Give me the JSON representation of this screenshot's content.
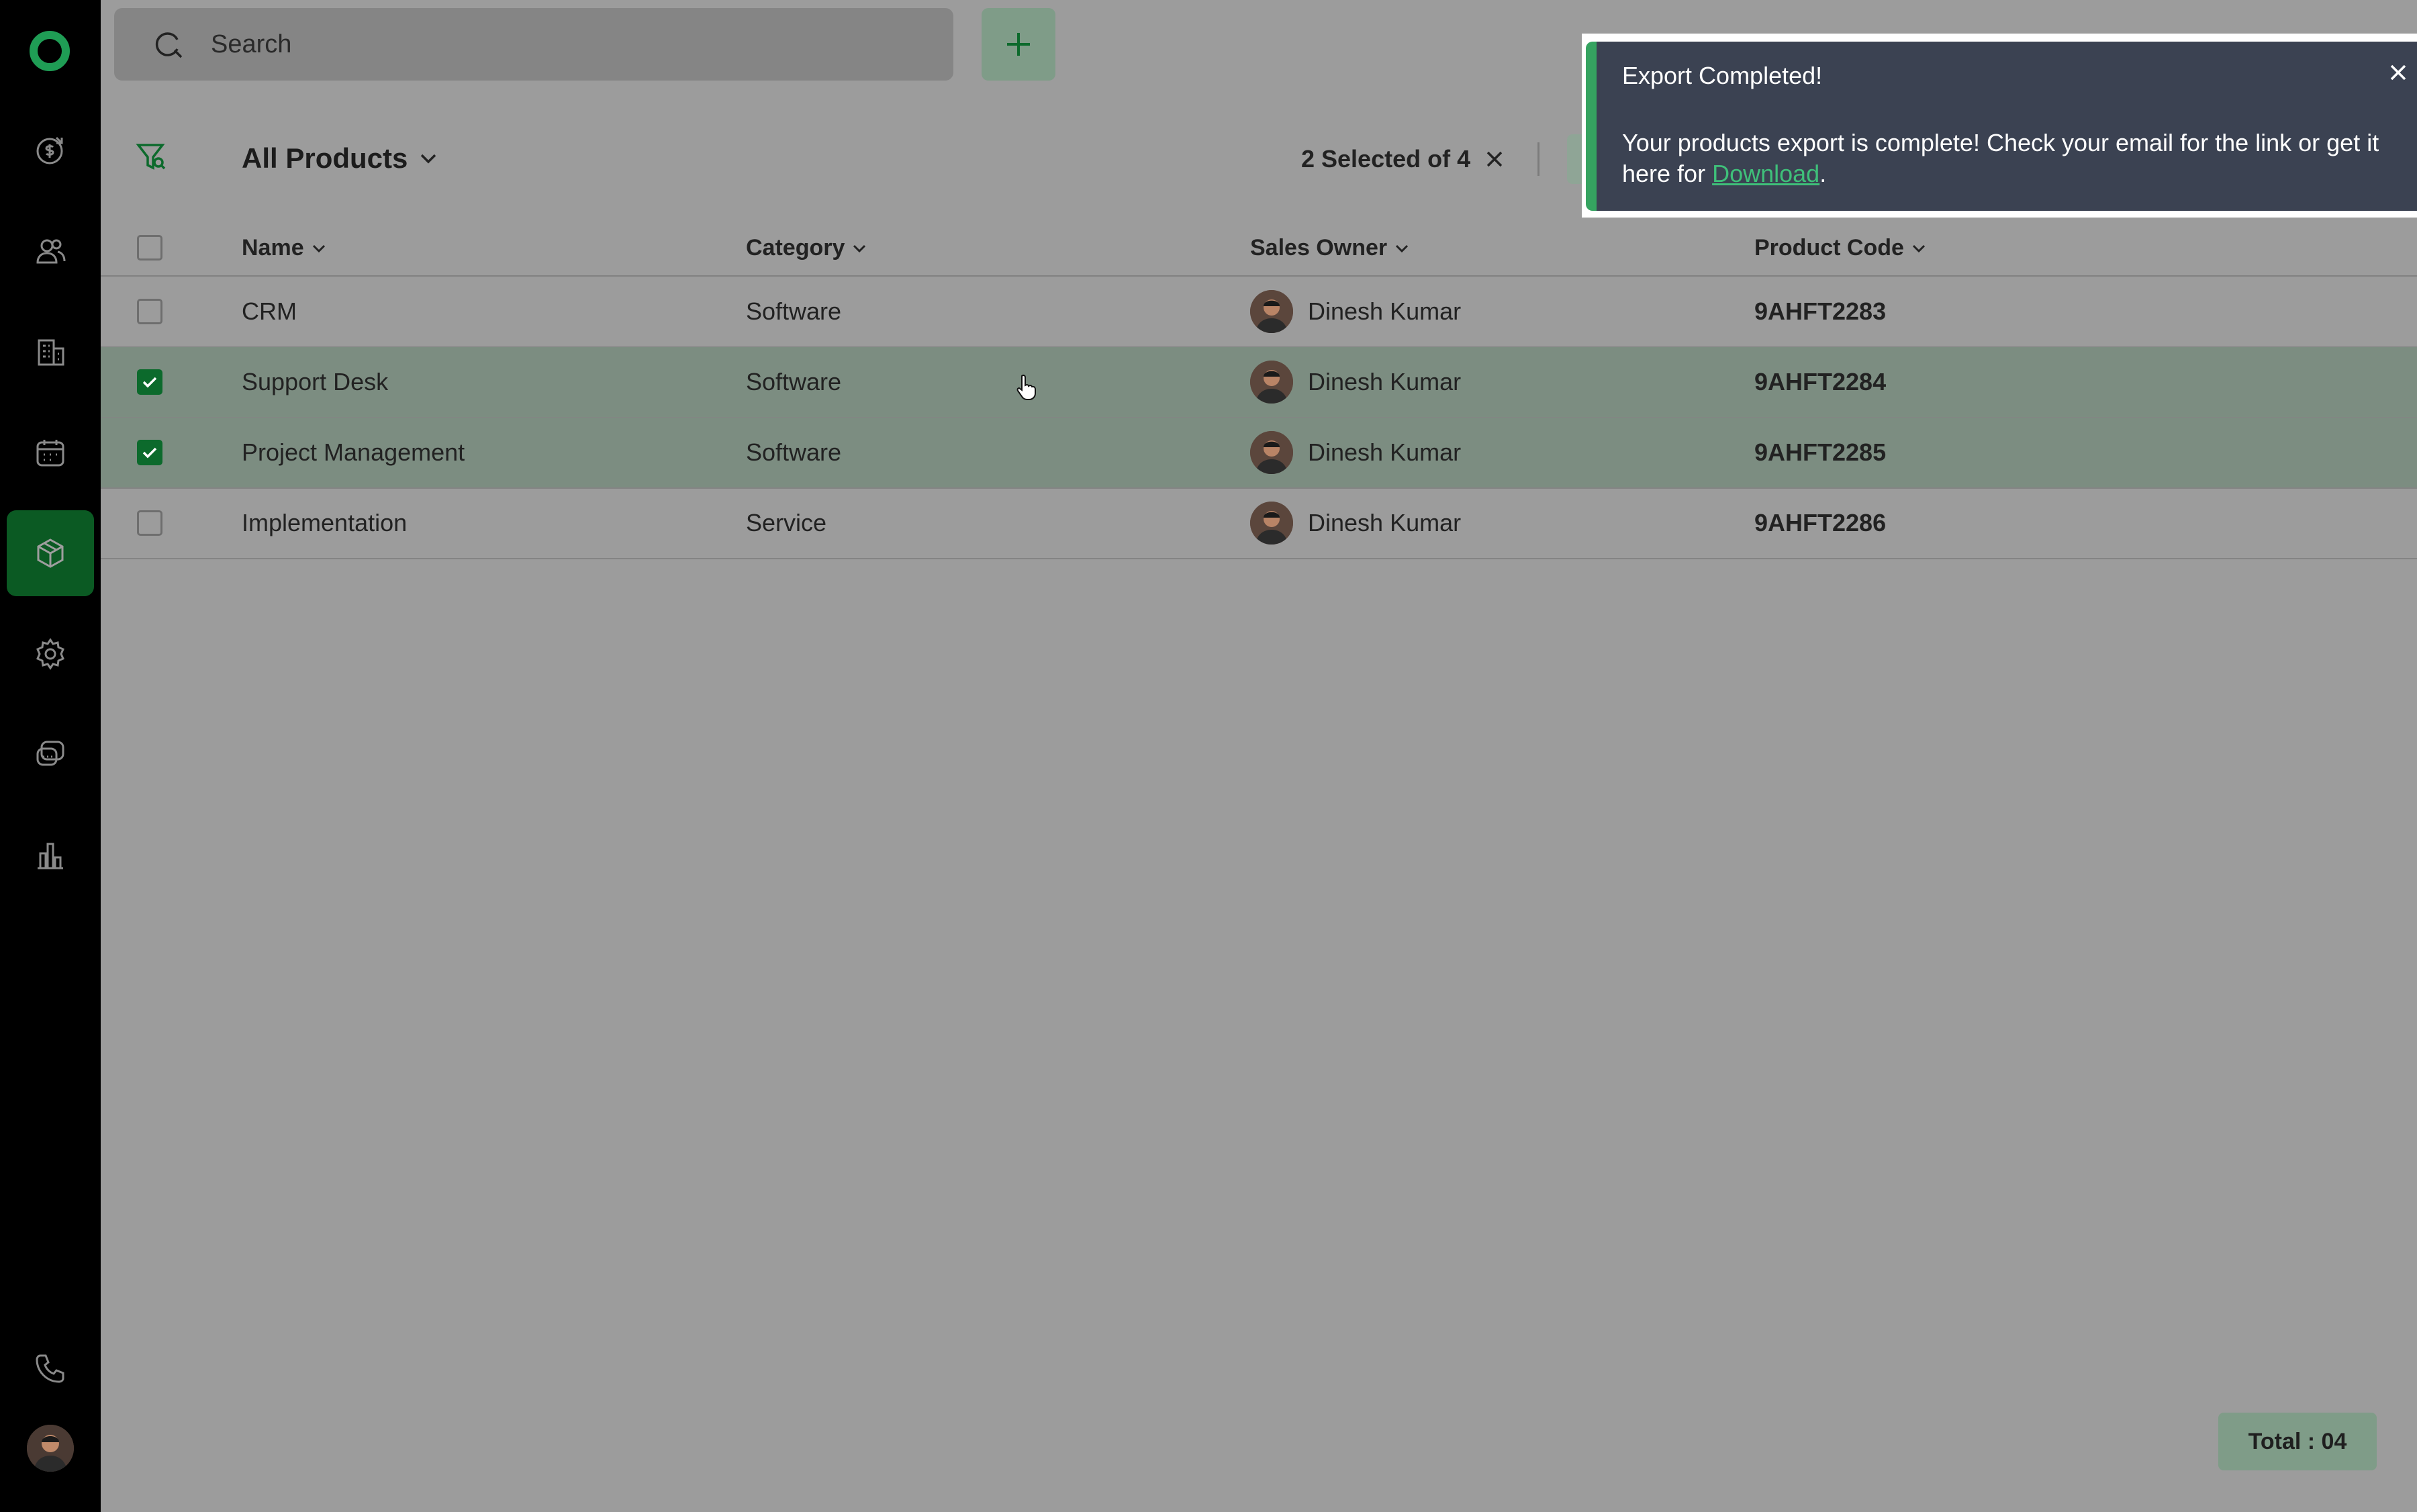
{
  "search": {
    "placeholder": "Search"
  },
  "toolbar": {
    "view_label": "All Products",
    "selection_text": "2 Selected of 4"
  },
  "table": {
    "columns": [
      "Name",
      "Category",
      "Sales Owner",
      "Product Code"
    ],
    "rows": [
      {
        "name": "CRM",
        "category": "Software",
        "owner": "Dinesh Kumar",
        "code": "9AHFT2283",
        "selected": false
      },
      {
        "name": "Support Desk",
        "category": "Software",
        "owner": "Dinesh Kumar",
        "code": "9AHFT2284",
        "selected": true
      },
      {
        "name": "Project Management",
        "category": "Software",
        "owner": "Dinesh Kumar",
        "code": "9AHFT2285",
        "selected": true
      },
      {
        "name": "Implementation",
        "category": "Service",
        "owner": "Dinesh Kumar",
        "code": "9AHFT2286",
        "selected": false
      }
    ]
  },
  "footer": {
    "total": "Total : 04"
  },
  "toast": {
    "title": "Export Completed!",
    "message": "Your products export is complete! Check your email for the link or get it here for ",
    "link": "Download",
    "end": "."
  },
  "sidebar": {
    "items": [
      "deals-icon",
      "contacts-icon",
      "companies-icon",
      "calendar-icon",
      "products-icon",
      "settings-icon",
      "chat-icon",
      "reports-icon",
      "phone-icon"
    ],
    "active": "products-icon"
  },
  "colors": {
    "accent": "#0b5a23",
    "toast_bg": "#3b4252",
    "toast_border": "#35a360",
    "link": "#3fc07a",
    "overlay_bg": "#9c9c9c"
  }
}
